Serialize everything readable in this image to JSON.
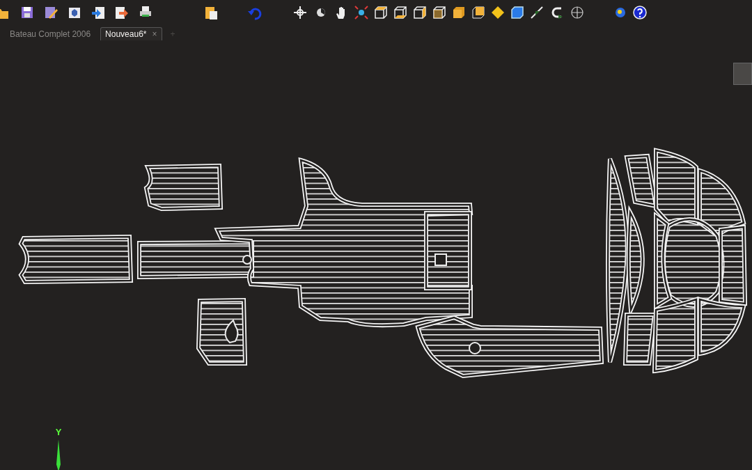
{
  "tabs": [
    {
      "label": "Bateau Complet 2006",
      "selected": false
    },
    {
      "label": "Nouveau6*",
      "selected": true,
      "close": "×"
    }
  ],
  "new_tab": "+",
  "axis": {
    "label": "Y"
  }
}
